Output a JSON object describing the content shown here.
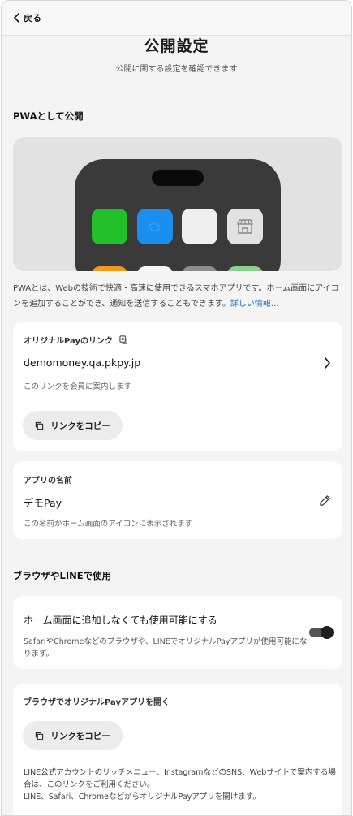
{
  "nav": {
    "back_label": "戻る"
  },
  "header": {
    "title": "公開設定",
    "subtitle": "公開に関する設定を確認できます"
  },
  "pwa": {
    "heading": "PWAとして公開",
    "description": "PWAとは、Webの技術で快適・高速に使用できるスマホアプリです。ホーム画面にアイコンを追加することができ、通知を送信することもできます。",
    "more_link": "詳しい情報...",
    "preview_apps": [
      {
        "name": "green-app-icon",
        "color": "#22c02a"
      },
      {
        "name": "blue-app-icon",
        "color": "#1a8fef"
      },
      {
        "name": "blank-app-icon",
        "color": "#efefef"
      },
      {
        "name": "store-app-icon",
        "color": "#e2e2e2"
      }
    ]
  },
  "link_card": {
    "label": "オリジナルPayのリンク",
    "url": "demomoney.qa.pkpy.jp",
    "note": "このリンクを会員に案内します",
    "copy_label": "リンクをコピー"
  },
  "name_card": {
    "label": "アプリの名前",
    "value": "デモPay",
    "note": "この名前がホーム画面のアイコンに表示されます"
  },
  "browser": {
    "heading": "ブラウザやLINEで使用",
    "toggle_title": "ホーム画面に追加しなくても使用可能にする",
    "toggle_note": "SafariやChromeなどのブラウザや、LINEでオリジナルPayアプリが使用可能になります。",
    "toggle_on": true,
    "open_card_label": "ブラウザでオリジナルPayアプリを開く",
    "copy_label": "リンクをコピー",
    "open_note_1": "LINE公式アカウントのリッチメニュー、InstagramなどのSNS、Webサイトで案内する場合は、このリンクをご利用ください。",
    "open_note_2": "LINE、Safari、ChromeなどからオリジナルPayアプリを開けます。"
  }
}
